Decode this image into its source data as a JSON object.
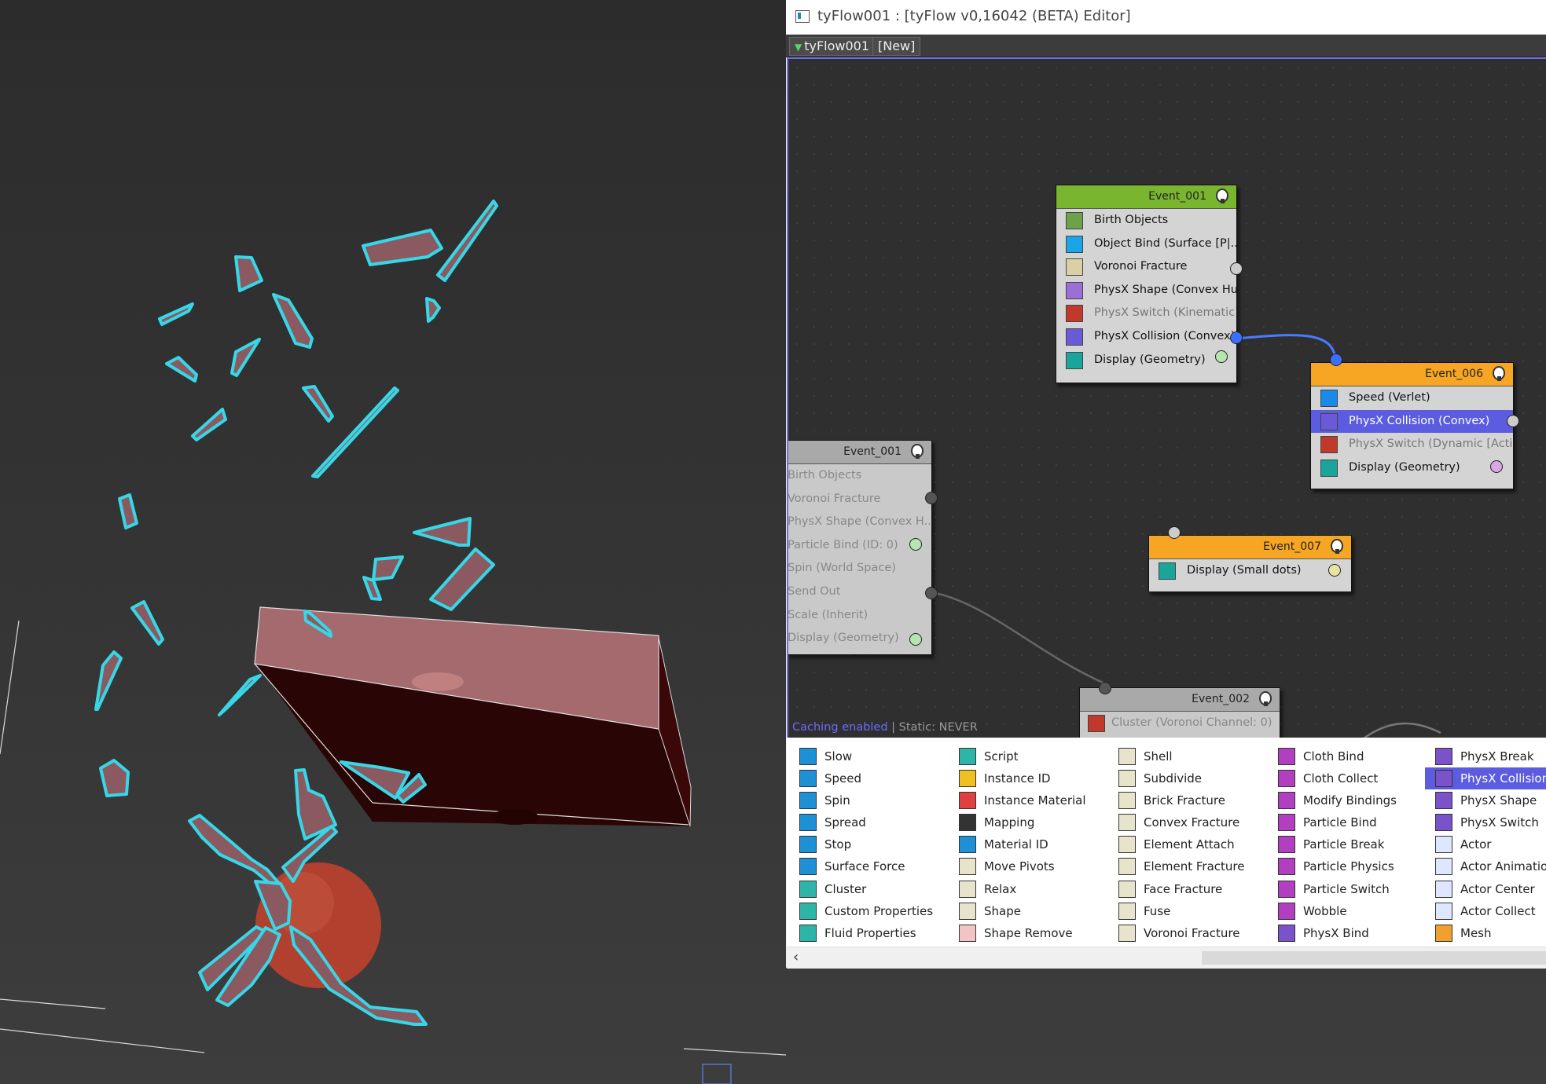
{
  "window": {
    "title": "tyFlow001 : [tyFlow v0,16042 (BETA) Editor]",
    "tabs": [
      "tyFlow001",
      "[New]"
    ]
  },
  "graph": {
    "nodes": [
      {
        "name": "Event_001",
        "header_color": "#79b52e",
        "operators": [
          {
            "label": "Birth Objects",
            "icon": "birth-objects-icon",
            "icon_color": "#6fa04a"
          },
          {
            "label": "Object Bind (Surface [P|...",
            "icon": "object-bind-icon",
            "icon_color": "#1aa5e8"
          },
          {
            "label": "Voronoi Fracture",
            "icon": "voronoi-fracture-icon",
            "icon_color": "#d9d0a6"
          },
          {
            "label": "PhysX Shape (Convex Hu...",
            "icon": "physx-shape-icon",
            "icon_color": "#9b6fd6"
          },
          {
            "label": "PhysX Switch (Kinematic)",
            "icon": "physx-switch-icon",
            "icon_color": "#c0392b",
            "disabled": true
          },
          {
            "label": "PhysX Collision (Convex)",
            "icon": "physx-collision-icon",
            "icon_color": "#6b5ad8"
          },
          {
            "label": "Display (Geometry)",
            "icon": "display-icon",
            "icon_color": "#1aa59a"
          }
        ]
      },
      {
        "name": "Event_006",
        "header_color": "#f6a623",
        "operators": [
          {
            "label": "Speed (Verlet)",
            "icon": "speed-icon",
            "icon_color": "#1a8ae8"
          },
          {
            "label": "PhysX Collision (Convex)",
            "icon": "physx-collision-icon",
            "icon_color": "#6b5ad8",
            "selected": true
          },
          {
            "label": "PhysX Switch (Dynamic [Acti...",
            "icon": "physx-switch-icon",
            "icon_color": "#c0392b",
            "disabled": true
          },
          {
            "label": "Display (Geometry)",
            "icon": "display-icon",
            "icon_color": "#1aa59a"
          }
        ]
      },
      {
        "name": "Event_007",
        "header_color": "#f6a623",
        "operators": [
          {
            "label": "Display (Small dots)",
            "icon": "display-icon",
            "icon_color": "#1aa59a"
          }
        ]
      },
      {
        "name": "Event_001",
        "header_color": "#a9a9a9",
        "operators": [
          {
            "label": "Birth Objects"
          },
          {
            "label": "Voronoi Fracture"
          },
          {
            "label": "PhysX Shape (Convex H..."
          },
          {
            "label": "Particle Bind (ID: 0)"
          },
          {
            "label": "Spin (World Space)"
          },
          {
            "label": "Send Out"
          },
          {
            "label": "Scale (Inherit)"
          },
          {
            "label": "Display (Geometry)"
          }
        ]
      },
      {
        "name": "Event_002",
        "header_color": "#a9a9a9",
        "operators": [
          {
            "label": "Cluster (Voronoi Channel: 0)",
            "icon": "cluster-icon",
            "icon_color": "#c0392b"
          }
        ]
      }
    ],
    "status": {
      "caching": "Caching enabled",
      "separator": " | ",
      "static": "Static: NEVER"
    }
  },
  "depot": {
    "columns": [
      [
        {
          "label": "Slow",
          "icon": "slow-icon"
        },
        {
          "label": "Speed",
          "icon": "speed-icon"
        },
        {
          "label": "Spin",
          "icon": "spin-icon"
        },
        {
          "label": "Spread",
          "icon": "spread-icon"
        },
        {
          "label": "Stop",
          "icon": "stop-icon"
        },
        {
          "label": "Surface Force",
          "icon": "surface-force-icon"
        },
        {
          "label": "Cluster",
          "icon": "cluster-icon"
        },
        {
          "label": "Custom Properties",
          "icon": "custom-properties-icon"
        },
        {
          "label": "Fluid Properties",
          "icon": "fluid-properties-icon"
        }
      ],
      [
        {
          "label": "Script",
          "icon": "script-icon"
        },
        {
          "label": "Instance ID",
          "icon": "instance-id-icon"
        },
        {
          "label": "Instance Material",
          "icon": "instance-material-icon"
        },
        {
          "label": "Mapping",
          "icon": "mapping-icon"
        },
        {
          "label": "Material ID",
          "icon": "material-id-icon"
        },
        {
          "label": "Move Pivots",
          "icon": "move-pivots-icon"
        },
        {
          "label": "Relax",
          "icon": "relax-icon"
        },
        {
          "label": "Shape",
          "icon": "shape-icon"
        },
        {
          "label": "Shape Remove",
          "icon": "shape-remove-icon"
        }
      ],
      [
        {
          "label": "Shell",
          "icon": "shell-icon"
        },
        {
          "label": "Subdivide",
          "icon": "subdivide-icon"
        },
        {
          "label": "Brick Fracture",
          "icon": "brick-fracture-icon"
        },
        {
          "label": "Convex Fracture",
          "icon": "convex-fracture-icon"
        },
        {
          "label": "Element Attach",
          "icon": "element-attach-icon"
        },
        {
          "label": "Element Fracture",
          "icon": "element-fracture-icon"
        },
        {
          "label": "Face Fracture",
          "icon": "face-fracture-icon"
        },
        {
          "label": "Fuse",
          "icon": "fuse-icon"
        },
        {
          "label": "Voronoi Fracture",
          "icon": "voronoi-fracture-icon"
        }
      ],
      [
        {
          "label": "Cloth Bind",
          "icon": "cloth-bind-icon"
        },
        {
          "label": "Cloth Collect",
          "icon": "cloth-collect-icon"
        },
        {
          "label": "Modify Bindings",
          "icon": "modify-bindings-icon"
        },
        {
          "label": "Particle Bind",
          "icon": "particle-bind-icon"
        },
        {
          "label": "Particle Break",
          "icon": "particle-break-icon"
        },
        {
          "label": "Particle Physics",
          "icon": "particle-physics-icon"
        },
        {
          "label": "Particle Switch",
          "icon": "particle-switch-icon"
        },
        {
          "label": "Wobble",
          "icon": "wobble-icon"
        },
        {
          "label": "PhysX Bind",
          "icon": "physx-bind-icon"
        }
      ],
      [
        {
          "label": "PhysX Break",
          "icon": "physx-break-icon"
        },
        {
          "label": "PhysX Collision",
          "icon": "physx-collision-icon",
          "selected": true
        },
        {
          "label": "PhysX Shape",
          "icon": "physx-shape-icon"
        },
        {
          "label": "PhysX Switch",
          "icon": "physx-switch-icon"
        },
        {
          "label": "Actor",
          "icon": "actor-icon"
        },
        {
          "label": "Actor Animation",
          "icon": "actor-animation-icon"
        },
        {
          "label": "Actor Center",
          "icon": "actor-center-icon"
        },
        {
          "label": "Actor Collect",
          "icon": "actor-collect-icon"
        },
        {
          "label": "Mesh",
          "icon": "mesh-icon"
        }
      ]
    ],
    "column_icon_colors": [
      "#1e90d6",
      "#2fb5a8",
      "#e8e4cc",
      "#b23fbf",
      "#7a52c9"
    ]
  },
  "colors": {
    "selection": "#5c5ce0",
    "wire": "#4a7bff",
    "fragment_outline": "#37d7e8",
    "fragment_fill": "#8a5a60"
  }
}
